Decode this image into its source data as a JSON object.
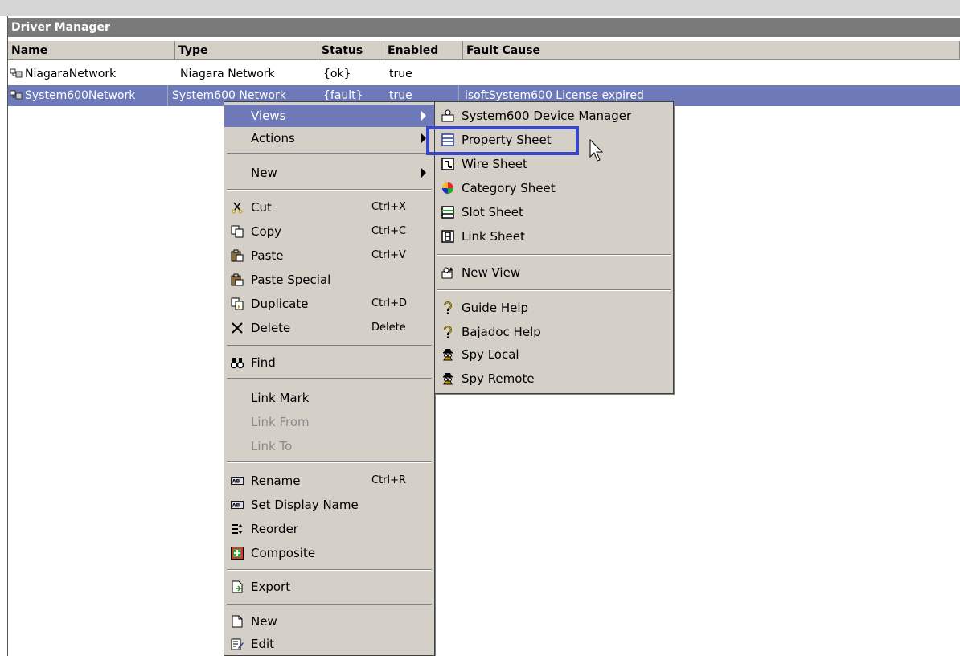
{
  "window": {
    "title": "Driver Manager"
  },
  "table": {
    "columns": [
      "Name",
      "Type",
      "Status",
      "Enabled",
      "Fault Cause"
    ],
    "rows": [
      {
        "name": "NiagaraNetwork",
        "type": "Niagara Network",
        "status": "{ok}",
        "enabled": "true",
        "fault": ""
      },
      {
        "name": "System600Network",
        "type": "System600 Network",
        "status": "{fault}",
        "enabled": "true",
        "fault": "isoftSystem600 License expired"
      }
    ]
  },
  "context_menu": {
    "views": "Views",
    "actions": "Actions",
    "new": "New",
    "cut": "Cut",
    "cut_sc": "Ctrl+X",
    "copy": "Copy",
    "copy_sc": "Ctrl+C",
    "paste": "Paste",
    "paste_sc": "Ctrl+V",
    "paste_special": "Paste Special",
    "duplicate": "Duplicate",
    "duplicate_sc": "Ctrl+D",
    "delete": "Delete",
    "delete_sc": "Delete",
    "find": "Find",
    "link_mark": "Link Mark",
    "link_from": "Link From",
    "link_to": "Link To",
    "rename": "Rename",
    "rename_sc": "Ctrl+R",
    "set_display_name": "Set Display Name",
    "reorder": "Reorder",
    "composite": "Composite",
    "export": "Export",
    "new2": "New",
    "edit": "Edit"
  },
  "views_submenu": {
    "device_manager": "System600 Device Manager",
    "property_sheet": "Property Sheet",
    "wire_sheet": "Wire Sheet",
    "category_sheet": "Category Sheet",
    "slot_sheet": "Slot Sheet",
    "link_sheet": "Link Sheet",
    "new_view": "New View",
    "guide_help": "Guide Help",
    "bajadoc_help": "Bajadoc Help",
    "spy_local": "Spy Local",
    "spy_remote": "Spy Remote"
  },
  "colors": {
    "selection": "#6e7ab8",
    "highlight_box": "#3a46c8",
    "menu_bg": "#d4d0c8",
    "title_bg": "#7a7a7a"
  }
}
